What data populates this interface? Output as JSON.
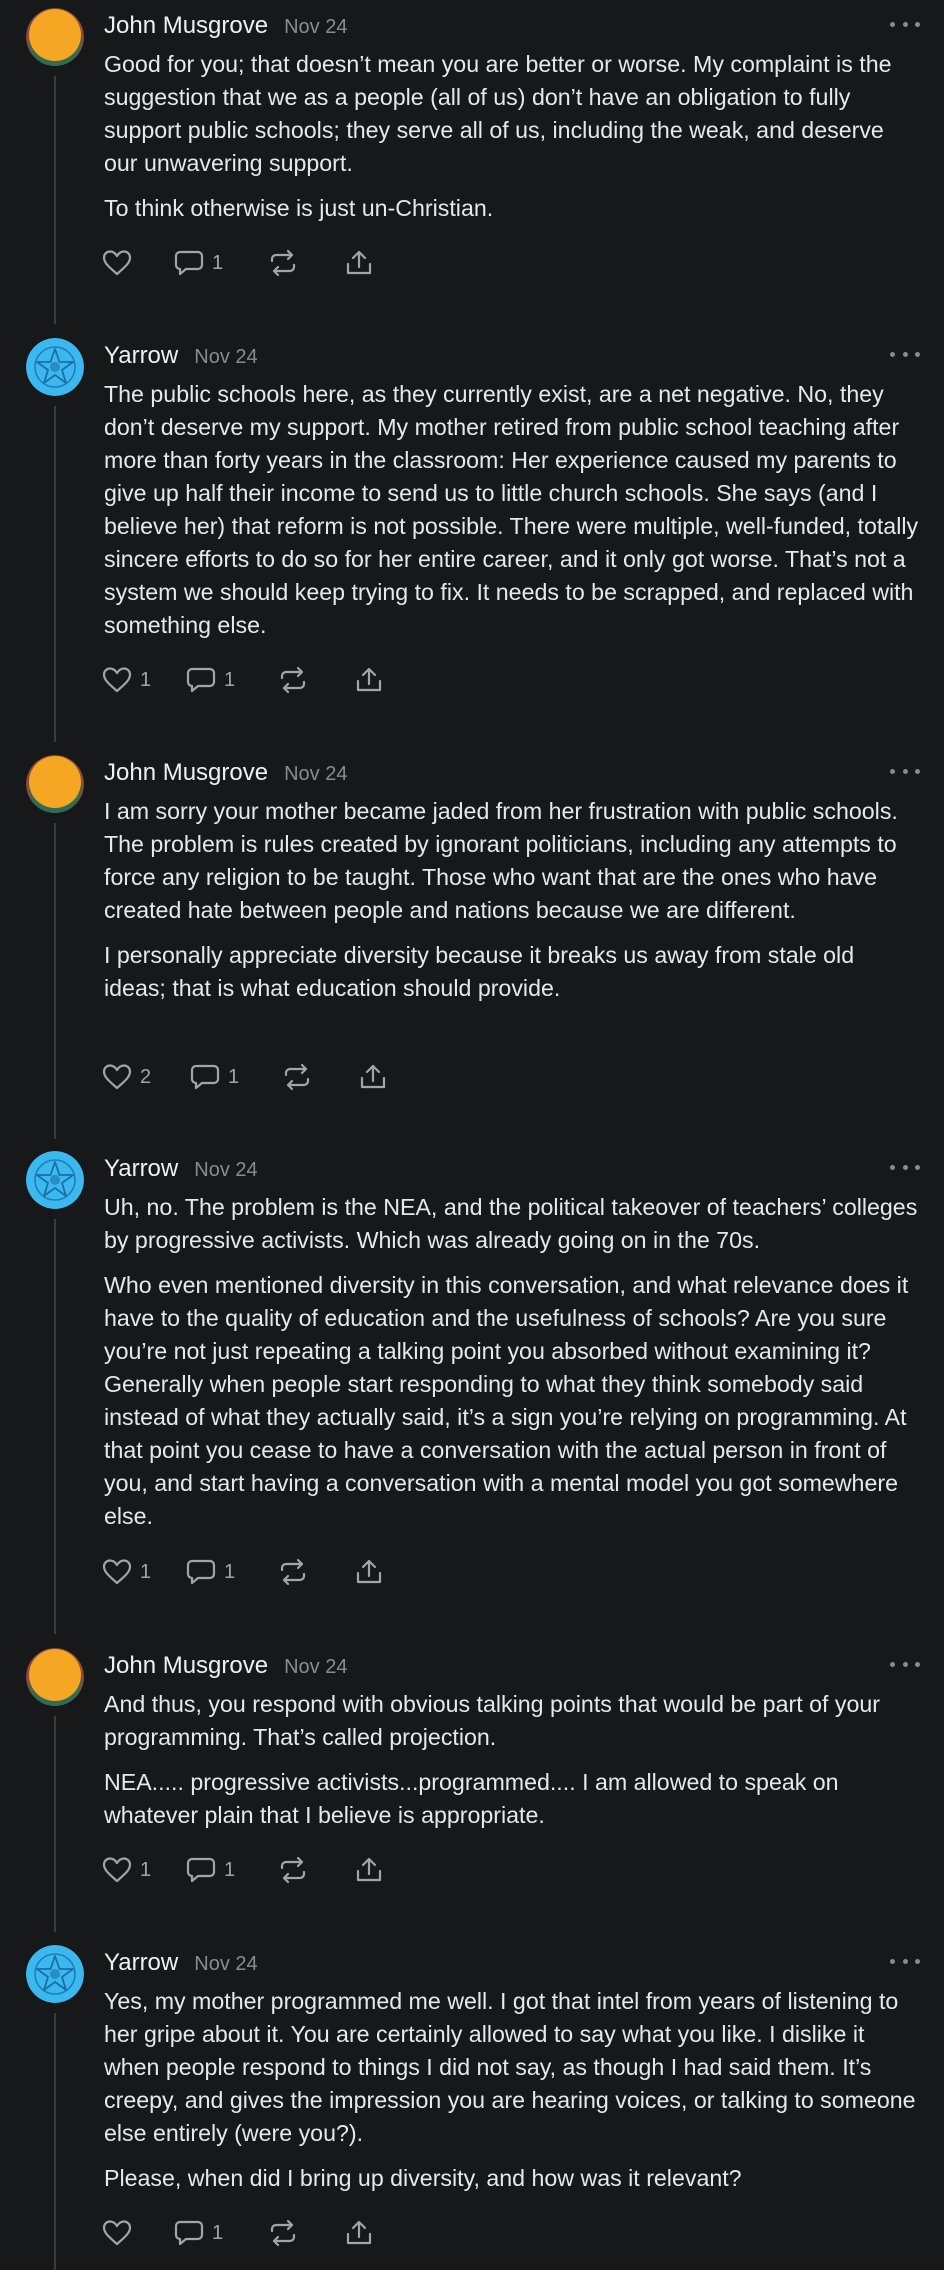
{
  "colors": {
    "background": "#17181a",
    "text": "#e8e8e8",
    "muted": "#8a8b8f",
    "icon": "#a3a4a8",
    "thread_line": "#3a3b3e",
    "john_avatar": "#f5a623",
    "yarrow_avatar": "#3bb8ef"
  },
  "comments": [
    {
      "author": "John Musgrove",
      "date": "Nov 24",
      "avatar": "orange-circle",
      "paragraphs": [
        "Good for you; that doesn’t mean you are better or worse. My complaint is the suggestion that we as a people (all of us) don’t have an obligation to fully support public schools; they serve all of us, including the weak, and deserve our unwavering support.",
        "To think otherwise is just un-Christian."
      ],
      "likes": "",
      "replies": "1"
    },
    {
      "author": "Yarrow",
      "date": "Nov 24",
      "avatar": "blue-star",
      "paragraphs": [
        "The public schools here, as they currently exist, are a net negative. No, they don’t deserve my support. My mother retired from public school teaching after more than forty years in the classroom: Her experience caused my parents to give up half their income to send us to little church schools. She says (and I believe her) that reform is not possible. There were multiple, well-funded, totally sincere efforts to do so for her entire career, and it only got worse. That’s not a system we should keep trying to fix. It needs to be scrapped, and replaced with something else."
      ],
      "likes": "1",
      "replies": "1"
    },
    {
      "author": "John Musgrove",
      "date": "Nov 24",
      "avatar": "orange-circle",
      "paragraphs": [
        "I am sorry your mother became jaded from her frustration with public schools. The problem is rules created by ignorant politicians, including any attempts to force any religion to be taught. Those who want that are the ones who have created hate between people and nations because we are different.",
        "I personally appreciate diversity because it breaks us away from stale old ideas; that is what education should provide."
      ],
      "likes": "2",
      "replies": "1"
    },
    {
      "author": "Yarrow",
      "date": "Nov 24",
      "avatar": "blue-star",
      "paragraphs": [
        "Uh, no. The problem is the NEA, and the political takeover of teachers’ colleges by progressive activists. Which was already going on in the 70s.",
        "Who even mentioned diversity in this conversation, and what relevance does it have to the quality of education and the usefulness of schools? Are you sure you’re not just repeating a talking point you absorbed without examining it? Generally when people start responding to what they think somebody said instead of what they actually said, it’s a sign you’re relying on programming. At that point you cease to have a conversation with the actual person in front of you, and start having a conversation with a mental model you got somewhere else."
      ],
      "likes": "1",
      "replies": "1"
    },
    {
      "author": "John Musgrove",
      "date": "Nov 24",
      "avatar": "orange-circle",
      "paragraphs": [
        "And thus, you respond with obvious talking points that would be part of your programming. That’s called projection.",
        "NEA..... progressive activists...programmed.... I am allowed to speak on whatever plain that I believe is appropriate."
      ],
      "likes": "1",
      "replies": "1"
    },
    {
      "author": "Yarrow",
      "date": "Nov 24",
      "avatar": "blue-star",
      "paragraphs": [
        "Yes, my mother programmed me well. I got that intel from years of listening to her gripe about it. You are certainly allowed to say what you like. I dislike it when people respond to things I did not say, as though I had said them. It’s creepy, and gives the impression you are hearing voices, or talking to someone else entirely (were you?).",
        "Please, when did I bring up diversity, and how was it relevant?"
      ],
      "likes": "",
      "replies": "1"
    }
  ]
}
